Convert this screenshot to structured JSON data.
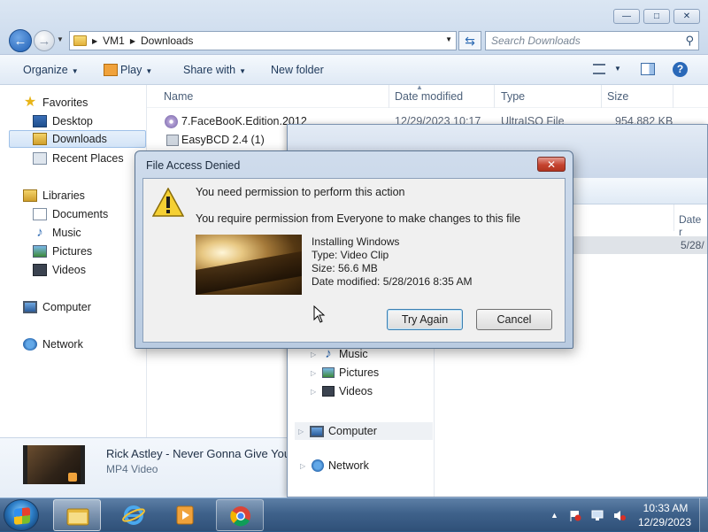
{
  "explorer": {
    "address": [
      "VM1",
      "Downloads"
    ],
    "search_placeholder": "Search Downloads",
    "toolbar": {
      "organize": "Organize",
      "play": "Play",
      "share_with": "Share with",
      "new_folder": "New folder"
    },
    "nav": {
      "favorites": "Favorites",
      "desktop": "Desktop",
      "downloads": "Downloads",
      "recent_places": "Recent Places",
      "libraries": "Libraries",
      "documents": "Documents",
      "music": "Music",
      "pictures": "Pictures",
      "videos": "Videos",
      "computer": "Computer",
      "network": "Network"
    },
    "columns": {
      "name": "Name",
      "date_modified": "Date modified",
      "type": "Type",
      "size": "Size"
    },
    "files": [
      {
        "name": "7.FaceBooK.Edition.2012",
        "date": "12/29/2023 10:17",
        "type": "UltraISO File",
        "size": "954,882 KB"
      },
      {
        "name": "EasyBCD 2.4 (1)"
      }
    ],
    "details": {
      "title": "Rick Astley - Never Gonna Give You",
      "type": "MP4 Video"
    }
  },
  "explorer2": {
    "date_head": "Date r",
    "row_date": "5/28/",
    "nav": {
      "music": "Music",
      "pictures": "Pictures",
      "videos": "Videos",
      "computer": "Computer",
      "network": "Network"
    }
  },
  "dialog": {
    "title": "File Access Denied",
    "message1": "You need permission to perform this action",
    "message2": "You require permission from Everyone to make changes to this file",
    "file_name": "Installing Windows",
    "file_type": "Type: Video Clip",
    "file_size": "Size: 56.6 MB",
    "file_date": "Date modified: 5/28/2016 8:35 AM",
    "try_again": "Try Again",
    "cancel": "Cancel"
  },
  "taskbar": {
    "time": "10:33 AM",
    "date": "12/29/2023"
  },
  "colors": {
    "taskbar": "#3f628b",
    "dialog_close": "#c5432f",
    "selection": "#d3e4f7"
  }
}
